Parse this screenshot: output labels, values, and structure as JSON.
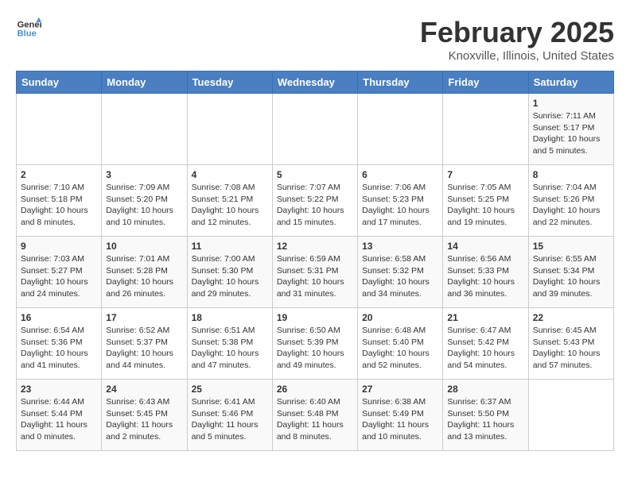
{
  "header": {
    "logo_line1": "General",
    "logo_line2": "Blue",
    "title": "February 2025",
    "subtitle": "Knoxville, Illinois, United States"
  },
  "weekdays": [
    "Sunday",
    "Monday",
    "Tuesday",
    "Wednesday",
    "Thursday",
    "Friday",
    "Saturday"
  ],
  "weeks": [
    [
      {
        "day": "",
        "sunrise": "",
        "sunset": "",
        "daylight": ""
      },
      {
        "day": "",
        "sunrise": "",
        "sunset": "",
        "daylight": ""
      },
      {
        "day": "",
        "sunrise": "",
        "sunset": "",
        "daylight": ""
      },
      {
        "day": "",
        "sunrise": "",
        "sunset": "",
        "daylight": ""
      },
      {
        "day": "",
        "sunrise": "",
        "sunset": "",
        "daylight": ""
      },
      {
        "day": "",
        "sunrise": "",
        "sunset": "",
        "daylight": ""
      },
      {
        "day": "1",
        "sunrise": "Sunrise: 7:11 AM",
        "sunset": "Sunset: 5:17 PM",
        "daylight": "Daylight: 10 hours and 5 minutes."
      }
    ],
    [
      {
        "day": "2",
        "sunrise": "Sunrise: 7:10 AM",
        "sunset": "Sunset: 5:18 PM",
        "daylight": "Daylight: 10 hours and 8 minutes."
      },
      {
        "day": "3",
        "sunrise": "Sunrise: 7:09 AM",
        "sunset": "Sunset: 5:20 PM",
        "daylight": "Daylight: 10 hours and 10 minutes."
      },
      {
        "day": "4",
        "sunrise": "Sunrise: 7:08 AM",
        "sunset": "Sunset: 5:21 PM",
        "daylight": "Daylight: 10 hours and 12 minutes."
      },
      {
        "day": "5",
        "sunrise": "Sunrise: 7:07 AM",
        "sunset": "Sunset: 5:22 PM",
        "daylight": "Daylight: 10 hours and 15 minutes."
      },
      {
        "day": "6",
        "sunrise": "Sunrise: 7:06 AM",
        "sunset": "Sunset: 5:23 PM",
        "daylight": "Daylight: 10 hours and 17 minutes."
      },
      {
        "day": "7",
        "sunrise": "Sunrise: 7:05 AM",
        "sunset": "Sunset: 5:25 PM",
        "daylight": "Daylight: 10 hours and 19 minutes."
      },
      {
        "day": "8",
        "sunrise": "Sunrise: 7:04 AM",
        "sunset": "Sunset: 5:26 PM",
        "daylight": "Daylight: 10 hours and 22 minutes."
      }
    ],
    [
      {
        "day": "9",
        "sunrise": "Sunrise: 7:03 AM",
        "sunset": "Sunset: 5:27 PM",
        "daylight": "Daylight: 10 hours and 24 minutes."
      },
      {
        "day": "10",
        "sunrise": "Sunrise: 7:01 AM",
        "sunset": "Sunset: 5:28 PM",
        "daylight": "Daylight: 10 hours and 26 minutes."
      },
      {
        "day": "11",
        "sunrise": "Sunrise: 7:00 AM",
        "sunset": "Sunset: 5:30 PM",
        "daylight": "Daylight: 10 hours and 29 minutes."
      },
      {
        "day": "12",
        "sunrise": "Sunrise: 6:59 AM",
        "sunset": "Sunset: 5:31 PM",
        "daylight": "Daylight: 10 hours and 31 minutes."
      },
      {
        "day": "13",
        "sunrise": "Sunrise: 6:58 AM",
        "sunset": "Sunset: 5:32 PM",
        "daylight": "Daylight: 10 hours and 34 minutes."
      },
      {
        "day": "14",
        "sunrise": "Sunrise: 6:56 AM",
        "sunset": "Sunset: 5:33 PM",
        "daylight": "Daylight: 10 hours and 36 minutes."
      },
      {
        "day": "15",
        "sunrise": "Sunrise: 6:55 AM",
        "sunset": "Sunset: 5:34 PM",
        "daylight": "Daylight: 10 hours and 39 minutes."
      }
    ],
    [
      {
        "day": "16",
        "sunrise": "Sunrise: 6:54 AM",
        "sunset": "Sunset: 5:36 PM",
        "daylight": "Daylight: 10 hours and 41 minutes."
      },
      {
        "day": "17",
        "sunrise": "Sunrise: 6:52 AM",
        "sunset": "Sunset: 5:37 PM",
        "daylight": "Daylight: 10 hours and 44 minutes."
      },
      {
        "day": "18",
        "sunrise": "Sunrise: 6:51 AM",
        "sunset": "Sunset: 5:38 PM",
        "daylight": "Daylight: 10 hours and 47 minutes."
      },
      {
        "day": "19",
        "sunrise": "Sunrise: 6:50 AM",
        "sunset": "Sunset: 5:39 PM",
        "daylight": "Daylight: 10 hours and 49 minutes."
      },
      {
        "day": "20",
        "sunrise": "Sunrise: 6:48 AM",
        "sunset": "Sunset: 5:40 PM",
        "daylight": "Daylight: 10 hours and 52 minutes."
      },
      {
        "day": "21",
        "sunrise": "Sunrise: 6:47 AM",
        "sunset": "Sunset: 5:42 PM",
        "daylight": "Daylight: 10 hours and 54 minutes."
      },
      {
        "day": "22",
        "sunrise": "Sunrise: 6:45 AM",
        "sunset": "Sunset: 5:43 PM",
        "daylight": "Daylight: 10 hours and 57 minutes."
      }
    ],
    [
      {
        "day": "23",
        "sunrise": "Sunrise: 6:44 AM",
        "sunset": "Sunset: 5:44 PM",
        "daylight": "Daylight: 11 hours and 0 minutes."
      },
      {
        "day": "24",
        "sunrise": "Sunrise: 6:43 AM",
        "sunset": "Sunset: 5:45 PM",
        "daylight": "Daylight: 11 hours and 2 minutes."
      },
      {
        "day": "25",
        "sunrise": "Sunrise: 6:41 AM",
        "sunset": "Sunset: 5:46 PM",
        "daylight": "Daylight: 11 hours and 5 minutes."
      },
      {
        "day": "26",
        "sunrise": "Sunrise: 6:40 AM",
        "sunset": "Sunset: 5:48 PM",
        "daylight": "Daylight: 11 hours and 8 minutes."
      },
      {
        "day": "27",
        "sunrise": "Sunrise: 6:38 AM",
        "sunset": "Sunset: 5:49 PM",
        "daylight": "Daylight: 11 hours and 10 minutes."
      },
      {
        "day": "28",
        "sunrise": "Sunrise: 6:37 AM",
        "sunset": "Sunset: 5:50 PM",
        "daylight": "Daylight: 11 hours and 13 minutes."
      },
      {
        "day": "",
        "sunrise": "",
        "sunset": "",
        "daylight": ""
      }
    ]
  ]
}
